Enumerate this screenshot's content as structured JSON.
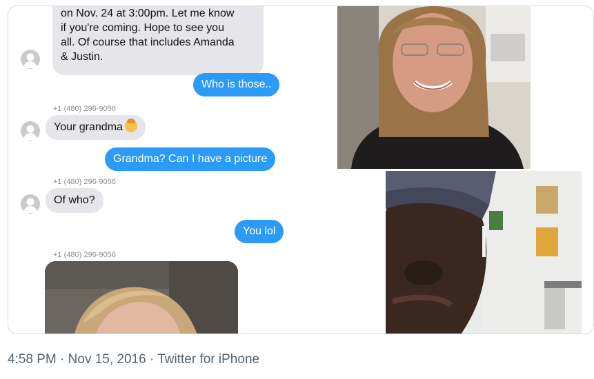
{
  "messages": {
    "first_lines": [
      "on Nov. 24 at 3:00pm.  Let me know",
      "if you're coming.  Hope to see you",
      "all.  Of course that includes Amanda",
      "& Justin."
    ],
    "out_1": "Who is those..",
    "sender_1": "+1 (480) 296-9056",
    "in_2": "Your grandma",
    "emoji_2": "older-woman-emoji",
    "out_2": "Grandma? Can I have a picture",
    "sender_2": "+1 (480) 296-9056",
    "in_3": "Of who?",
    "out_3": "You lol",
    "sender_3": "+1 (480) 296-9056"
  },
  "meta": {
    "time": "4:58 PM",
    "date": "Nov 15, 2016",
    "source": "Twitter for iPhone",
    "separator": "·"
  },
  "colors": {
    "incoming_bubble": "#e5e5ea",
    "outgoing_bubble": "#2b9bf7",
    "meta_text": "#536471"
  }
}
